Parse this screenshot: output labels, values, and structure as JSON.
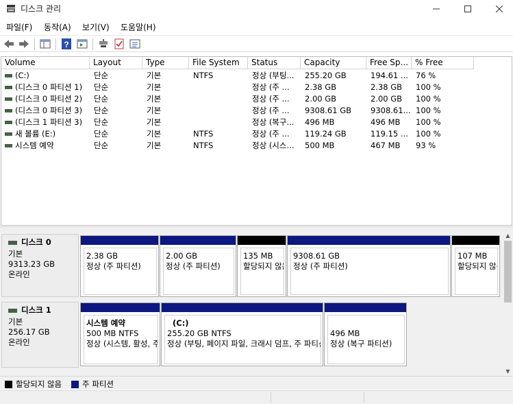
{
  "window": {
    "title": "디스크 관리"
  },
  "menu": [
    "파일(F)",
    "동작(A)",
    "보기(V)",
    "도움말(H)"
  ],
  "toolbar": {
    "icons": [
      "back-arrow-icon",
      "forward-arrow-icon",
      "console-tree-icon",
      "help-icon",
      "properties-icon",
      "connect-icon",
      "checklist-icon",
      "settings-list-icon"
    ]
  },
  "list": {
    "columns": [
      "Volume",
      "Layout",
      "Type",
      "File System",
      "Status",
      "Capacity",
      "Free Sp...",
      "% Free"
    ],
    "rows": [
      [
        "(C:)",
        "단순",
        "기본",
        "NTFS",
        "정상 (부팅...",
        "255.20 GB",
        "194.61 ...",
        "76 %"
      ],
      [
        "(디스크 0 파티션 1)",
        "단순",
        "기본",
        "",
        "정상 (주 ...",
        "2.38 GB",
        "2.38 GB",
        "100 %"
      ],
      [
        "(디스크 0 파티션 2)",
        "단순",
        "기본",
        "",
        "정상 (주 ...",
        "2.00 GB",
        "2.00 GB",
        "100 %"
      ],
      [
        "(디스크 0 파티션 3)",
        "단순",
        "기본",
        "",
        "정상 (주 ...",
        "9308.61 GB",
        "9308.61...",
        "100 %"
      ],
      [
        "(디스크 1 파티션 3)",
        "단순",
        "기본",
        "",
        "정상 (복구...",
        "496 MB",
        "496 MB",
        "100 %"
      ],
      [
        "새 볼륨 (E:)",
        "단순",
        "기본",
        "NTFS",
        "정상 (주 ...",
        "119.24 GB",
        "119.15 ...",
        "100 %"
      ],
      [
        "시스템 예약",
        "단순",
        "기본",
        "NTFS",
        "정상 (시스...",
        "500 MB",
        "467 MB",
        "93 %"
      ]
    ]
  },
  "disks": [
    {
      "name": "디스크 0",
      "type": "기본",
      "size": "9313.23 GB",
      "status": "온라인",
      "partitions": [
        {
          "name": "",
          "size": "2.38 GB",
          "status": "정상 (주 파티션)",
          "kind": "primary"
        },
        {
          "name": "",
          "size": "2.00 GB",
          "status": "정상 (주 파티션)",
          "kind": "primary"
        },
        {
          "name": "",
          "size": "135 MB",
          "status": "할당되지 않음",
          "kind": "unalloc"
        },
        {
          "name": "",
          "size": "9308.61 GB",
          "status": "정상 (주 파티션)",
          "kind": "primary"
        },
        {
          "name": "",
          "size": "107 MB",
          "status": "할당되지 않음",
          "kind": "unalloc"
        }
      ]
    },
    {
      "name": "디스크 1",
      "type": "기본",
      "size": "256.17 GB",
      "status": "온라인",
      "partitions": [
        {
          "name": "시스템 예약",
          "size": "500 MB NTFS",
          "status": "정상 (시스템, 활성, 주 파티션)",
          "kind": "primary"
        },
        {
          "name": "(C:)",
          "size": "255.20 GB NTFS",
          "status": "정상 (부팅, 페이지 파일, 크래시 덤프, 주 파티션)",
          "kind": "primary"
        },
        {
          "name": "",
          "size": "496 MB",
          "status": "정상 (복구 파티션)",
          "kind": "primary"
        }
      ]
    }
  ],
  "legend": [
    {
      "label": "할당되지 않음",
      "color": "#000000"
    },
    {
      "label": "주 파티션",
      "color": "#0c1880"
    }
  ]
}
